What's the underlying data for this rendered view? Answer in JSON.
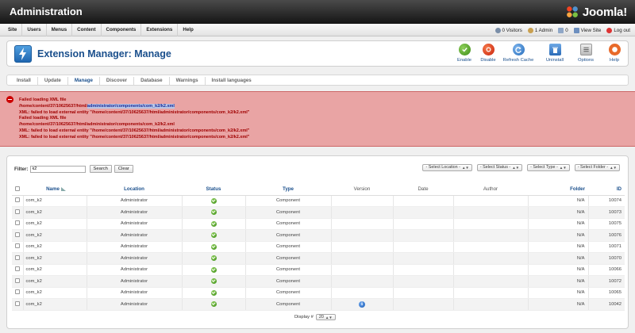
{
  "header": {
    "title": "Administration",
    "logo_text": "Joomla!"
  },
  "menu": {
    "items": [
      "Site",
      "Users",
      "Menus",
      "Content",
      "Components",
      "Extensions",
      "Help"
    ]
  },
  "status": {
    "visitors": "0 Visitors",
    "admins": "1 Admin",
    "messages": "0",
    "view_site": "View Site",
    "logout": "Log out"
  },
  "toolbar": {
    "page_title": "Extension Manager: Manage",
    "enable": "Enable",
    "disable": "Disable",
    "refresh_cache": "Refresh Cache",
    "uninstall": "Uninstall",
    "options": "Options",
    "help": "Help"
  },
  "tabs": [
    "Install",
    "Update",
    "Manage",
    "Discover",
    "Database",
    "Warnings",
    "Install languages"
  ],
  "active_tab": "Manage",
  "errors": [
    "Failed loading XML file",
    "/home/content/37/10625637/html/administrator/components/com_k2/k2.xml",
    "XML: failed to load external entity \"/home/content/37/10625637/html/administrator/components/com_k2/k2.xml\"",
    "Failed loading XML file",
    "/home/content/37/10625637/html/administrator/components/com_k2/k2.xml",
    "XML: failed to load external entity \"/home/content/37/10625637/html/administrator/components/com_k2/k2.xml\"",
    "XML: failed to load external entity \"/home/content/37/10625637/html/administrator/components/com_k2/k2.xml\""
  ],
  "errors_highlight": {
    "prefix": "/home/content/37/10625637/html/",
    "selected": "administrator/components/com_k2/k2.xml"
  },
  "filter": {
    "label": "Filter:",
    "value": "k2",
    "search": "Search",
    "clear": "Clear"
  },
  "selects": {
    "location": "- Select Location -",
    "status": "- Select Status -",
    "type": "- Select Type -",
    "folder": "- Select Folder -"
  },
  "table": {
    "columns": {
      "name": "Name",
      "location": "Location",
      "status": "Status",
      "type": "Type",
      "version": "Version",
      "date": "Date",
      "author": "Author",
      "folder": "Folder",
      "id": "ID"
    },
    "rows": [
      {
        "name": "com_k2",
        "location": "Administrator",
        "type": "Component",
        "version": "",
        "date": "",
        "author": "",
        "folder": "N/A",
        "id": "10074"
      },
      {
        "name": "com_k2",
        "location": "Administrator",
        "type": "Component",
        "version": "",
        "date": "",
        "author": "",
        "folder": "N/A",
        "id": "10073"
      },
      {
        "name": "com_k2",
        "location": "Administrator",
        "type": "Component",
        "version": "",
        "date": "",
        "author": "",
        "folder": "N/A",
        "id": "10075"
      },
      {
        "name": "com_k2",
        "location": "Administrator",
        "type": "Component",
        "version": "",
        "date": "",
        "author": "",
        "folder": "N/A",
        "id": "10076"
      },
      {
        "name": "com_k2",
        "location": "Administrator",
        "type": "Component",
        "version": "",
        "date": "",
        "author": "",
        "folder": "N/A",
        "id": "10071"
      },
      {
        "name": "com_k2",
        "location": "Administrator",
        "type": "Component",
        "version": "",
        "date": "",
        "author": "",
        "folder": "N/A",
        "id": "10070"
      },
      {
        "name": "com_k2",
        "location": "Administrator",
        "type": "Component",
        "version": "",
        "date": "",
        "author": "",
        "folder": "N/A",
        "id": "10066"
      },
      {
        "name": "com_k2",
        "location": "Administrator",
        "type": "Component",
        "version": "",
        "date": "",
        "author": "",
        "folder": "N/A",
        "id": "10072"
      },
      {
        "name": "com_k2",
        "location": "Administrator",
        "type": "Component",
        "version": "",
        "date": "",
        "author": "",
        "folder": "N/A",
        "id": "10065"
      },
      {
        "name": "com_k2",
        "location": "Administrator",
        "type": "Component",
        "version": "info-icon",
        "date": "",
        "author": "",
        "folder": "N/A",
        "id": "10042"
      }
    ]
  },
  "pager": {
    "label": "Display #",
    "value": "20"
  },
  "colors": {
    "brand_blue": "#1a4f8c",
    "error_bg": "#e9a4a4",
    "error_text": "#a00000",
    "ok_green": "#3a8a16"
  }
}
